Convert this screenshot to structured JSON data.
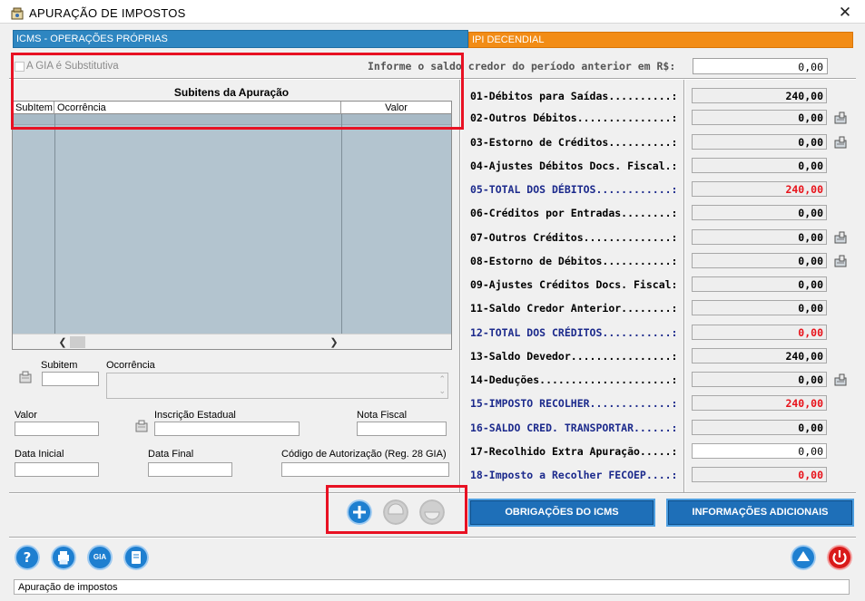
{
  "window": {
    "title": "APURAÇÃO DE IMPOSTOS",
    "close_symbol": "✕"
  },
  "tabs": {
    "icms": "ICMS - OPERAÇÕES PRÓPRIAS",
    "ipi": "IPI DECENDIAL"
  },
  "gia": {
    "label": "A GIA é Substitutiva",
    "checked": false
  },
  "saldo": {
    "label": "Informe o saldo credor do período anterior em R$:",
    "value": "0,00"
  },
  "subitens": {
    "title": "Subitens da Apuração",
    "columns": [
      "SubItem",
      "Ocorrência",
      "Valor"
    ],
    "rows": []
  },
  "form": {
    "subitem_label": "Subitem",
    "ocorrencia_label": "Ocorrência",
    "valor_label": "Valor",
    "inscricao_label": "Inscrição Estadual",
    "nota_label": "Nota Fiscal",
    "data_inicial_label": "Data Inicial",
    "data_final_label": "Data Final",
    "codigo_label": "Código de Autorização (Reg. 28 GIA)"
  },
  "apuracao": [
    {
      "label": "01-Débitos para Saídas..........:",
      "value": "240,00",
      "total": false,
      "color": "black",
      "icon": false
    },
    {
      "label": "02-Outros Débitos...............:",
      "value": "0,00",
      "total": false,
      "color": "black",
      "icon": true
    },
    {
      "label": "03-Estorno de Créditos..........:",
      "value": "0,00",
      "total": false,
      "color": "black",
      "icon": true
    },
    {
      "label": "04-Ajustes Débitos Docs. Fiscal.:",
      "value": "0,00",
      "total": false,
      "color": "black",
      "icon": false
    },
    {
      "label": "05-TOTAL DOS DÉBITOS............:",
      "value": "240,00",
      "total": true,
      "color": "red",
      "icon": false
    },
    {
      "label": "06-Créditos por Entradas........:",
      "value": "0,00",
      "total": false,
      "color": "black",
      "icon": false
    },
    {
      "label": "07-Outros Créditos..............:",
      "value": "0,00",
      "total": false,
      "color": "black",
      "icon": true
    },
    {
      "label": "08-Estorno de Débitos...........:",
      "value": "0,00",
      "total": false,
      "color": "black",
      "icon": true
    },
    {
      "label": "09-Ajustes Créditos Docs. Fiscal:",
      "value": "0,00",
      "total": false,
      "color": "black",
      "icon": false
    },
    {
      "label": "11-Saldo Credor Anterior........:",
      "value": "0,00",
      "total": false,
      "color": "black",
      "icon": false
    },
    {
      "label": "12-TOTAL DOS CRÉDITOS...........:",
      "value": "0,00",
      "total": true,
      "color": "red",
      "icon": false
    },
    {
      "label": "13-Saldo Devedor................:",
      "value": "240,00",
      "total": false,
      "color": "black",
      "icon": false
    },
    {
      "label": "14-Deduções.....................:",
      "value": "0,00",
      "total": false,
      "color": "black",
      "icon": true
    },
    {
      "label": "15-IMPOSTO RECOLHER.............:",
      "value": "240,00",
      "total": true,
      "color": "red",
      "icon": false
    },
    {
      "label": "16-SALDO CRED. TRANSPORTAR......:",
      "value": "0,00",
      "total": true,
      "color": "black",
      "icon": false
    },
    {
      "label": "17-Recolhido Extra Apuração.....:",
      "value": "0,00",
      "total": false,
      "color": "black",
      "icon": false,
      "editable": true
    },
    {
      "label": "18-Imposto a Recolher FECOEP....:",
      "value": "0,00",
      "total": true,
      "color": "red",
      "icon": false
    }
  ],
  "buttons": {
    "obrigacoes": "OBRIGAÇÕES DO ICMS",
    "informacoes": "INFORMAÇÕES ADICIONAIS",
    "gia_icon_text": "GIA"
  },
  "status": {
    "text": "Apuração de impostos"
  },
  "colors": {
    "icms_tab": "#2e86c1",
    "ipi_tab": "#f28c16",
    "total_text": "#1c2a8c",
    "red_value": "#e8121a",
    "button_blue": "#1e6fb8",
    "highlight": "#e81123"
  }
}
